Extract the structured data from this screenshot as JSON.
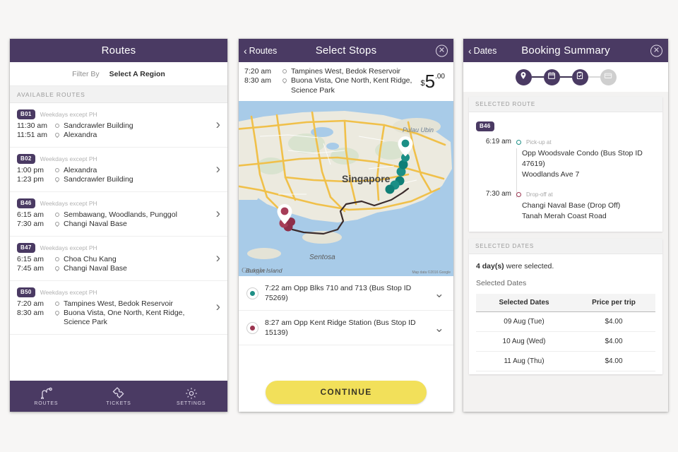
{
  "app": {
    "accent_purple": "#4a3a63",
    "accent_yellow": "#f2e05a",
    "teal": "#1f8f86",
    "maroon": "#9b3550",
    "background": "#f7f6f5"
  },
  "routes_screen": {
    "title": "Routes",
    "filter": {
      "label": "Filter By",
      "value": "Select A Region"
    },
    "section_header": "AVAILABLE ROUTES",
    "routes": [
      {
        "code": "B01",
        "days": "Weekdays except PH",
        "legs": [
          {
            "time": "11:30 am",
            "place": "Sandcrawler Building"
          },
          {
            "time": "11:51 am",
            "place": "Alexandra"
          }
        ]
      },
      {
        "code": "B02",
        "days": "Weekdays except PH",
        "legs": [
          {
            "time": "1:00 pm",
            "place": "Alexandra"
          },
          {
            "time": "1:23 pm",
            "place": "Sandcrawler Building"
          }
        ]
      },
      {
        "code": "B46",
        "days": "Weekdays except PH",
        "legs": [
          {
            "time": "6:15 am",
            "place": "Sembawang, Woodlands, Punggol"
          },
          {
            "time": "7:30 am",
            "place": "Changi Naval Base"
          }
        ]
      },
      {
        "code": "B47",
        "days": "Weekdays except PH",
        "legs": [
          {
            "time": "6:15 am",
            "place": "Choa Chu Kang"
          },
          {
            "time": "7:45 am",
            "place": "Changi Naval Base"
          }
        ]
      },
      {
        "code": "B50",
        "days": "Weekdays except PH",
        "legs": [
          {
            "time": "7:20 am",
            "place": "Tampines West, Bedok Reservoir"
          },
          {
            "time": "8:30 am",
            "place": "Buona Vista, One North, Kent Ridge, Science Park"
          }
        ]
      }
    ],
    "tabs": [
      {
        "label": "ROUTES",
        "icon": "route-icon"
      },
      {
        "label": "TICKETS",
        "icon": "ticket-icon"
      },
      {
        "label": "SETTINGS",
        "icon": "gear-icon"
      }
    ]
  },
  "stops_screen": {
    "back_label": "Routes",
    "title": "Select Stops",
    "close_icon": "close-icon",
    "trip": {
      "legs": [
        {
          "time": "7:20 am",
          "place": "Tampines West, Bedok Reservoir"
        },
        {
          "time": "8:30 am",
          "place": "Buona Vista, One North, Kent Ridge, Science Park"
        }
      ],
      "price_currency": "$",
      "price_whole": "5",
      "price_cents": ".00"
    },
    "map": {
      "city_label": "Singapore",
      "island_labels": [
        "Pulau Ubin",
        "Sentosa",
        "Bukom Island"
      ],
      "watermark": "Google",
      "attribution": "Map data ©2016 Google"
    },
    "stops": [
      {
        "time": "7:22 am",
        "name": "Opp Blks 710 and 713 (Bus Stop ID 75269)",
        "marker_color": "#1f8f86"
      },
      {
        "time": "8:27 am",
        "name": "Opp Kent Ridge Station (Bus Stop ID 15139)",
        "marker_color": "#9b3550"
      }
    ],
    "continue_label": "CONTINUE"
  },
  "summary_screen": {
    "back_label": "Dates",
    "title": "Booking Summary",
    "close_icon": "close-icon",
    "steps": [
      {
        "icon": "location-pin-icon",
        "state": "done"
      },
      {
        "icon": "calendar-icon",
        "state": "done"
      },
      {
        "icon": "clipboard-check-icon",
        "state": "current"
      },
      {
        "icon": "payment-card-icon",
        "state": "inactive"
      }
    ],
    "selected_route": {
      "header": "SELECTED ROUTE",
      "code": "B46",
      "pickup": {
        "time": "6:19 am",
        "kind": "Pick-up at",
        "line1": "Opp Woodsvale Condo (Bus Stop ID 47619)",
        "line2": "Woodlands Ave 7"
      },
      "dropoff": {
        "time": "7:30 am",
        "kind": "Drop-off at",
        "line1": "Changi Naval Base (Drop Off)",
        "line2": "Tanah Merah Coast Road"
      }
    },
    "selected_dates": {
      "header": "SELECTED DATES",
      "count_text_bold": "4 day(s)",
      "count_text_rest": " were selected.",
      "subtitle": "Selected Dates",
      "columns": [
        "Selected Dates",
        "Price per trip"
      ],
      "rows": [
        {
          "date": "09 Aug (Tue)",
          "price": "$4.00"
        },
        {
          "date": "10 Aug (Wed)",
          "price": "$4.00"
        },
        {
          "date": "11 Aug (Thu)",
          "price": "$4.00"
        }
      ]
    }
  }
}
